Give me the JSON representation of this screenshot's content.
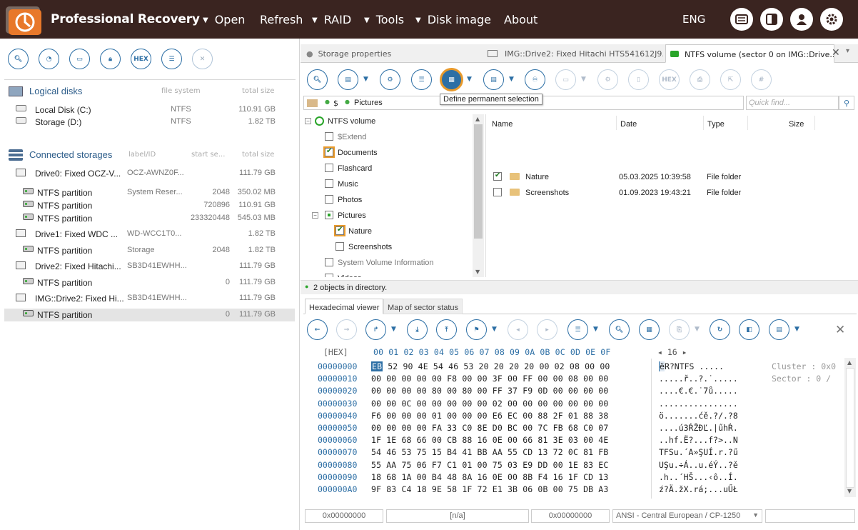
{
  "app": {
    "title": "Professional Recovery",
    "lang": "ENG"
  },
  "menu": [
    {
      "label": "Open",
      "arrow": true
    },
    {
      "label": "Refresh",
      "arrow": false
    },
    {
      "label": "RAID",
      "arrow": true
    },
    {
      "label": "Tools",
      "arrow": true
    },
    {
      "label": "Disk image",
      "arrow": true
    },
    {
      "label": "About",
      "arrow": false
    }
  ],
  "left_toolbar": {
    "hex_label": "HEX"
  },
  "logical": {
    "title": "Logical disks",
    "col_fs": "file system",
    "col_size": "total size",
    "items": [
      {
        "name": "Local Disk (C:)",
        "fs": "NTFS",
        "size": "110.91 GB"
      },
      {
        "name": "Storage (D:)",
        "fs": "NTFS",
        "size": "1.82 TB"
      }
    ]
  },
  "storages": {
    "title": "Connected storages",
    "col_label": "label/ID",
    "col_start": "start se...",
    "col_size": "total size",
    "items": [
      {
        "name": "Drive0: Fixed OCZ-V...",
        "label": "OCZ-AWNZ0F...",
        "start": "",
        "size": "111.79 GB",
        "kind": "drive"
      },
      {
        "name": "NTFS partition",
        "label": "System Reser...",
        "start": "2048",
        "size": "350.02 MB",
        "kind": "part"
      },
      {
        "name": "NTFS partition",
        "label": "",
        "start": "720896",
        "size": "110.91 GB",
        "kind": "part"
      },
      {
        "name": "NTFS partition",
        "label": "",
        "start": "233320448",
        "size": "545.03 MB",
        "kind": "part"
      },
      {
        "name": "Drive1: Fixed WDC ...",
        "label": "WD-WCC1T0...",
        "start": "",
        "size": "1.82 TB",
        "kind": "drive"
      },
      {
        "name": "NTFS partition",
        "label": "Storage",
        "start": "2048",
        "size": "1.82 TB",
        "kind": "part"
      },
      {
        "name": "Drive2: Fixed Hitachi...",
        "label": "SB3D41EWHH...",
        "start": "",
        "size": "111.79 GB",
        "kind": "drive"
      },
      {
        "name": "NTFS partition",
        "label": "",
        "start": "0",
        "size": "111.79 GB",
        "kind": "part"
      },
      {
        "name": "IMG::Drive2: Fixed Hi...",
        "label": "SB3D41EWHH...",
        "start": "",
        "size": "111.79 GB",
        "kind": "drive"
      },
      {
        "name": "NTFS partition",
        "label": "",
        "start": "0",
        "size": "111.79 GB",
        "kind": "part"
      }
    ]
  },
  "tabs": [
    {
      "label": "Storage properties"
    },
    {
      "label": "IMG::Drive2: Fixed Hitachi HTS541612J9..."
    },
    {
      "label": "NTFS volume (sector 0 on IMG::Drive..."
    }
  ],
  "toolbar": {
    "hex_label": "HEX",
    "tooltip": "Define permanent selection"
  },
  "path": {
    "root": "$",
    "folder": "Pictures"
  },
  "find": {
    "placeholder": "Quick find..."
  },
  "tree": {
    "root": "NTFS volume",
    "items": [
      {
        "label": "$Extend",
        "state": "none",
        "gray": true
      },
      {
        "label": "Documents",
        "state": "chk",
        "gray": false
      },
      {
        "label": "Flashcard",
        "state": "none",
        "gray": false
      },
      {
        "label": "Music",
        "state": "none",
        "gray": false
      },
      {
        "label": "Photos",
        "state": "none",
        "gray": false
      },
      {
        "label": "Pictures",
        "state": "part",
        "gray": false
      },
      {
        "label": "Nature",
        "state": "chk",
        "gray": false
      },
      {
        "label": "Screenshots",
        "state": "none",
        "gray": false
      },
      {
        "label": "System Volume Information",
        "state": "none",
        "gray": true
      },
      {
        "label": "Videos",
        "state": "none",
        "gray": false
      }
    ]
  },
  "files": {
    "headers": [
      "Name",
      "Date",
      "Type",
      "Size"
    ],
    "rows": [
      {
        "name": "Nature",
        "date": "05.03.2025 10:39:58",
        "type": "File folder",
        "checked": true
      },
      {
        "name": "Screenshots",
        "date": "01.09.2023 19:43:21",
        "type": "File folder",
        "checked": false
      }
    ]
  },
  "status": {
    "text": "2 objects in directory."
  },
  "lower_tabs": [
    {
      "label": "Hexadecimal viewer"
    },
    {
      "label": "Map of sector status"
    }
  ],
  "hex": {
    "header_label": "[HEX]",
    "columns": "00 01 02 03 04 05 06 07 08 09 0A 0B 0C 0D 0E 0F",
    "width_ctrl": "◂ 16 ▸",
    "first_byte": "EB",
    "first_char": "ë",
    "info": [
      "Cluster : 0x0",
      "Sector : 0 /"
    ],
    "rows": [
      {
        "off": "00000000",
        "hex": "52 90 4E 54 46 53 20 20 20 20 00 02 08 00 00",
        "asc": "R?NTFS    ....."
      },
      {
        "off": "00000010",
        "hex": "00 00 00 00 00 F8 00 00 3F 00 FF 00 00 08 00 00",
        "asc": ".....ř..?.˙....."
      },
      {
        "off": "00000020",
        "hex": "00 00 00 00 80 00 80 00 FF 37 F9 0D 00 00 00 00",
        "asc": "....€.€.˙7ů....."
      },
      {
        "off": "00000030",
        "hex": "00 00 0C 00 00 00 00 00 02 00 00 00 00 00 00 00",
        "asc": "................"
      },
      {
        "off": "00000040",
        "hex": "F6 00 00 00 01 00 00 00 E6 EC 00 88 2F 01 88 38",
        "asc": "ö.......ćě.?/.?8"
      },
      {
        "off": "00000050",
        "hex": "00 00 00 00 FA 33 C0 8E D0 BC 00 7C FB 68 C0 07",
        "asc": "....ú3ŔŽĐĽ.|űhŔ."
      },
      {
        "off": "00000060",
        "hex": "1F 1E 68 66 00 CB 88 16 0E 00 66 81 3E 03 00 4E",
        "asc": "..hf.Ë?...f?>..N"
      },
      {
        "off": "00000070",
        "hex": "54 46 53 75 15 B4 41 BB AA 55 CD 13 72 0C 81 FB",
        "asc": "TFSu.´A»ŞUÍ.r.?ű"
      },
      {
        "off": "00000080",
        "hex": "55 AA 75 06 F7 C1 01 00 75 03 E9 DD 00 1E 83 EC",
        "asc": "UŞu.÷Á..u.éÝ..?ě"
      },
      {
        "off": "00000090",
        "hex": "18 68 1A 00 B4 48 8A 16 0E 00 8B F4 16 1F CD 13",
        "asc": ".h..´HŠ...‹ô..Í."
      },
      {
        "off": "000000A0",
        "hex": "9F 83 C4 18 9E 58 1F 72 E1 3B 06 0B 00 75 DB A3",
        "asc": "ź?Ä.žX.rá;...uŰŁ"
      }
    ]
  },
  "bottom": {
    "offset": "0x00000000",
    "na": "[n/a]",
    "offset2": "0x00000000",
    "encoding": "ANSI - Central European / CP-1250"
  },
  "colors": {
    "title_bg": "#3a2420",
    "accent": "#2d6fa5",
    "highlight": "#e89a2c"
  }
}
